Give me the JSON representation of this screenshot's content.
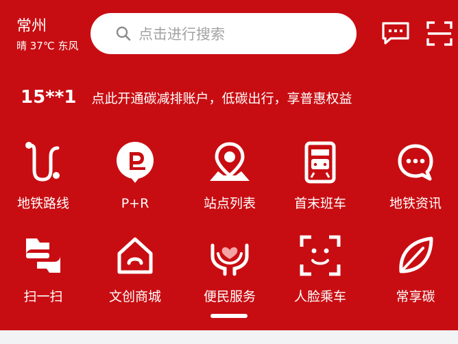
{
  "header": {
    "city": "常州",
    "weather": "晴 37℃ 东风",
    "search_placeholder": "点击进行搜索"
  },
  "account": {
    "number": "15**1",
    "message": "点此开通碳减排账户，低碳出行，享普惠权益"
  },
  "services": [
    {
      "label": "地铁路线",
      "icon": "metro-route-icon"
    },
    {
      "label": "P+R",
      "icon": "park-and-ride-icon"
    },
    {
      "label": "站点列表",
      "icon": "station-pin-icon"
    },
    {
      "label": "首末班车",
      "icon": "train-icon"
    },
    {
      "label": "地铁资讯",
      "icon": "chat-bubble-icon"
    },
    {
      "label": "扫一扫",
      "icon": "scan-icon"
    },
    {
      "label": "文创商城",
      "icon": "shop-house-icon"
    },
    {
      "label": "便民服务",
      "icon": "care-hands-icon"
    },
    {
      "label": "人脸乘车",
      "icon": "face-scan-icon"
    },
    {
      "label": "常享碳",
      "icon": "leaf-icon"
    }
  ],
  "colors": {
    "brand": "#c80d12",
    "page_bg": "#f2f3f5"
  }
}
